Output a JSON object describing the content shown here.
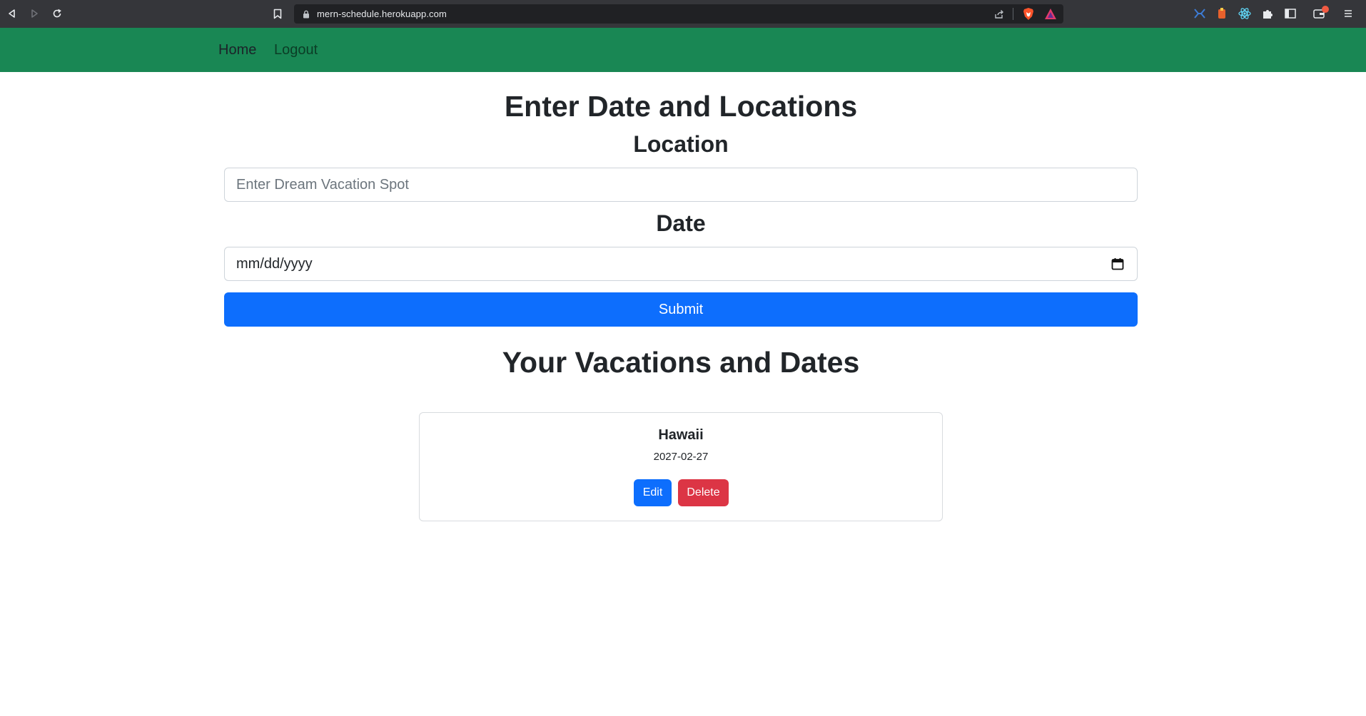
{
  "browser": {
    "url": "mern-schedule.herokuapp.com"
  },
  "navbar": {
    "home_label": "Home",
    "logout_label": "Logout",
    "color": "#198754"
  },
  "form": {
    "heading": "Enter Date and Locations",
    "location_label": "Location",
    "location_placeholder": "Enter Dream Vacation Spot",
    "date_label": "Date",
    "date_value": "mm/dd/yyyy",
    "submit_label": "Submit"
  },
  "list": {
    "heading": "Your Vacations and Dates",
    "items": [
      {
        "location": "Hawaii",
        "date": "2027-02-27",
        "edit_label": "Edit",
        "delete_label": "Delete"
      }
    ]
  },
  "colors": {
    "primary": "#0d6efd",
    "danger": "#dc3545"
  }
}
